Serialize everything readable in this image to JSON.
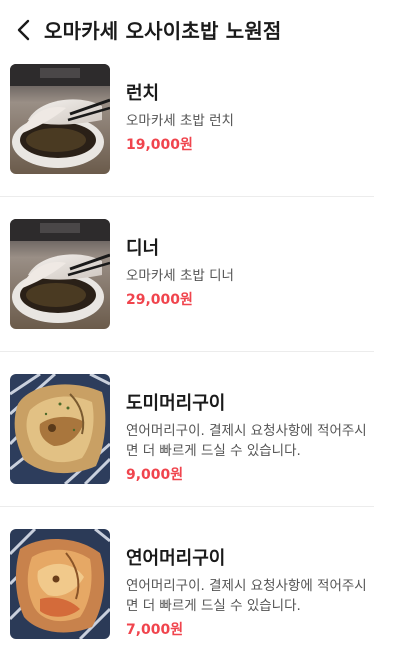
{
  "header": {
    "title": "오마카세 오사이초밥 노원점",
    "back_icon": "back-arrow-icon"
  },
  "colors": {
    "price": "#f0444d",
    "text": "#1a1a1a",
    "subtext": "#555555",
    "divider": "#ececec"
  },
  "menu": {
    "items": [
      {
        "name": "런치",
        "description": "오마카세 초밥 런치",
        "price": "19,000원",
        "image": "sushi-photo"
      },
      {
        "name": "디너",
        "description": "오마카세 초밥 디너",
        "price": "29,000원",
        "image": "sushi-photo"
      },
      {
        "name": "도미머리구이",
        "description": "연어머리구이. 결제시 요청사항에 적어주시면 더 빠르게 드실 수 있습니다.",
        "price": "9,000원",
        "image": "grilled-fish-head-photo"
      },
      {
        "name": "연어머리구이",
        "description": "연어머리구이. 결제시 요청사항에 적어주시면 더 빠르게 드실 수 있습니다.",
        "price": "7,000원",
        "image": "grilled-fish-head-photo"
      }
    ]
  }
}
